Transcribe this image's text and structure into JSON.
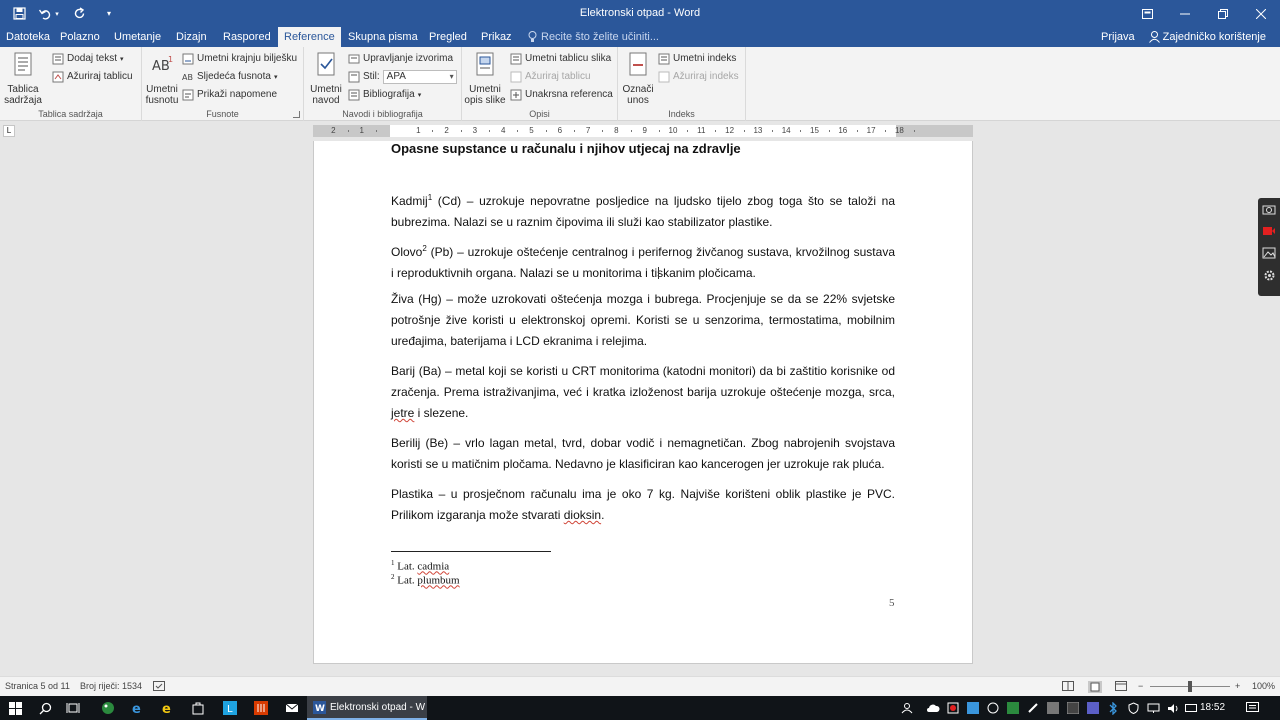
{
  "titlebar": {
    "title": "Elektronski otpad - Word"
  },
  "tabs": [
    {
      "label": "Datoteka"
    },
    {
      "label": "Polazno"
    },
    {
      "label": "Umetanje"
    },
    {
      "label": "Dizajn"
    },
    {
      "label": "Raspored"
    },
    {
      "label": "Reference"
    },
    {
      "label": "Skupna pisma"
    },
    {
      "label": "Pregled"
    },
    {
      "label": "Prikaz"
    }
  ],
  "tell_me": "Recite što želite učiniti...",
  "account": {
    "signin": "Prijava",
    "share": "Zajedničko korištenje"
  },
  "ribbon": {
    "toc_group": {
      "label": "Tablica sadržaja",
      "big": "Tablica sadržaja",
      "add_text": "Dodaj tekst",
      "update": "Ažuriraj tablicu"
    },
    "footnotes_group": {
      "label": "Fusnote",
      "big": "Umetni fusnotu",
      "insert_endnote": "Umetni krajnju bilješku",
      "next_footnote": "Sljedeća fusnota",
      "show_notes": "Prikaži napomene"
    },
    "citations_group": {
      "label": "Navodi i bibliografija",
      "big": "Umetni navod",
      "manage": "Upravljanje izvorima",
      "style_label": "Stil:",
      "style_value": "APA",
      "bibliography": "Bibliografija"
    },
    "captions_group": {
      "label": "Opisi",
      "big": "Umetni opis slike",
      "insert_table": "Umetni tablicu slika",
      "update_table": "Ažuriraj tablicu",
      "cross_ref": "Unakrsna referenca"
    },
    "index_group": {
      "label": "Indeks",
      "big": "Označi unos",
      "insert_index": "Umetni indeks",
      "update_index": "Ažuriraj indeks"
    }
  },
  "ruler": {
    "tab_selector": "L",
    "numbers": [
      "2",
      "1",
      "1",
      "2",
      "3",
      "4",
      "5",
      "6",
      "7",
      "8",
      "9",
      "10",
      "11",
      "12",
      "13",
      "14",
      "15",
      "16",
      "17",
      "18"
    ]
  },
  "document": {
    "heading": "Opasne supstance u računalu i njihov utjecaj na zdravlje",
    "paragraphs": [
      {
        "lead": "Kadmij",
        "sup": "1",
        "text": " (Cd) – uzrokuje nepovratne posljedice na ljudsko tijelo zbog toga što se taloži na bubrezima. Nalazi se u raznim čipovima ili služi kao stabilizator plastike."
      },
      {
        "lead": "Olovo",
        "sup": "2",
        "text": " (Pb) – uzrokuje oštećenje centralnog i perifernog živčanog sustava, krvožilnog sustava i reproduktivnih organa. Nalazi se u monitorima i tiskanim pločicama."
      },
      {
        "lead": "Živa",
        "sup": "",
        "text": " (Hg) – može uzrokovati oštećenja mozga i bubrega. Procjenjuje se da se 22% svjetske potrošnje žive koristi u elektronskoj opremi. Koristi se u senzorima, termostatima, mobilnim uređajima, baterijama i LCD ekranima i relejima."
      },
      {
        "lead": "Barij",
        "sup": "",
        "text": " (Ba) – metal koji se koristi u CRT monitorima (katodni monitori) da bi zaštitio korisnike od zračenja. Prema istraživanjima, već i kratka izloženost barija uzrokuje oštećenje mozga, srca, ",
        "wavy": "jetre",
        "tail": " i slezene."
      },
      {
        "lead": "Berilij",
        "sup": "",
        "text": " (Be) – vrlo lagan metal, tvrd, dobar vodič i nemagnetičan. Zbog nabrojenih svojstava koristi se u matičnim pločama. Nedavno je klasificiran kao kancerogen jer uzrokuje rak pluća."
      },
      {
        "lead": "Plastika",
        "sup": "",
        "text": " – u prosječnom računalu ima je oko 7 kg. Najviše korišteni oblik plastike je PVC. Prilikom izgaranja može stvarati ",
        "wavy": "dioksin",
        "tail": "."
      }
    ],
    "footnotes": [
      {
        "num": "1",
        "prefix": "Lat. ",
        "word": "cadmia"
      },
      {
        "num": "2",
        "prefix": "Lat. ",
        "word": "plumbum"
      }
    ],
    "page_number": "5"
  },
  "statusbar": {
    "page": "Stranica 5 od 11",
    "words": "Broj riječi: 1534",
    "zoom": "100%",
    "zoom_level": 100
  },
  "taskbar": {
    "word_item": "Elektronski otpad - W",
    "time": "18:52"
  },
  "colors": {
    "accent": "#2b579a",
    "ribbon_bg": "#f3f3f3",
    "taskbar": "#101418"
  }
}
